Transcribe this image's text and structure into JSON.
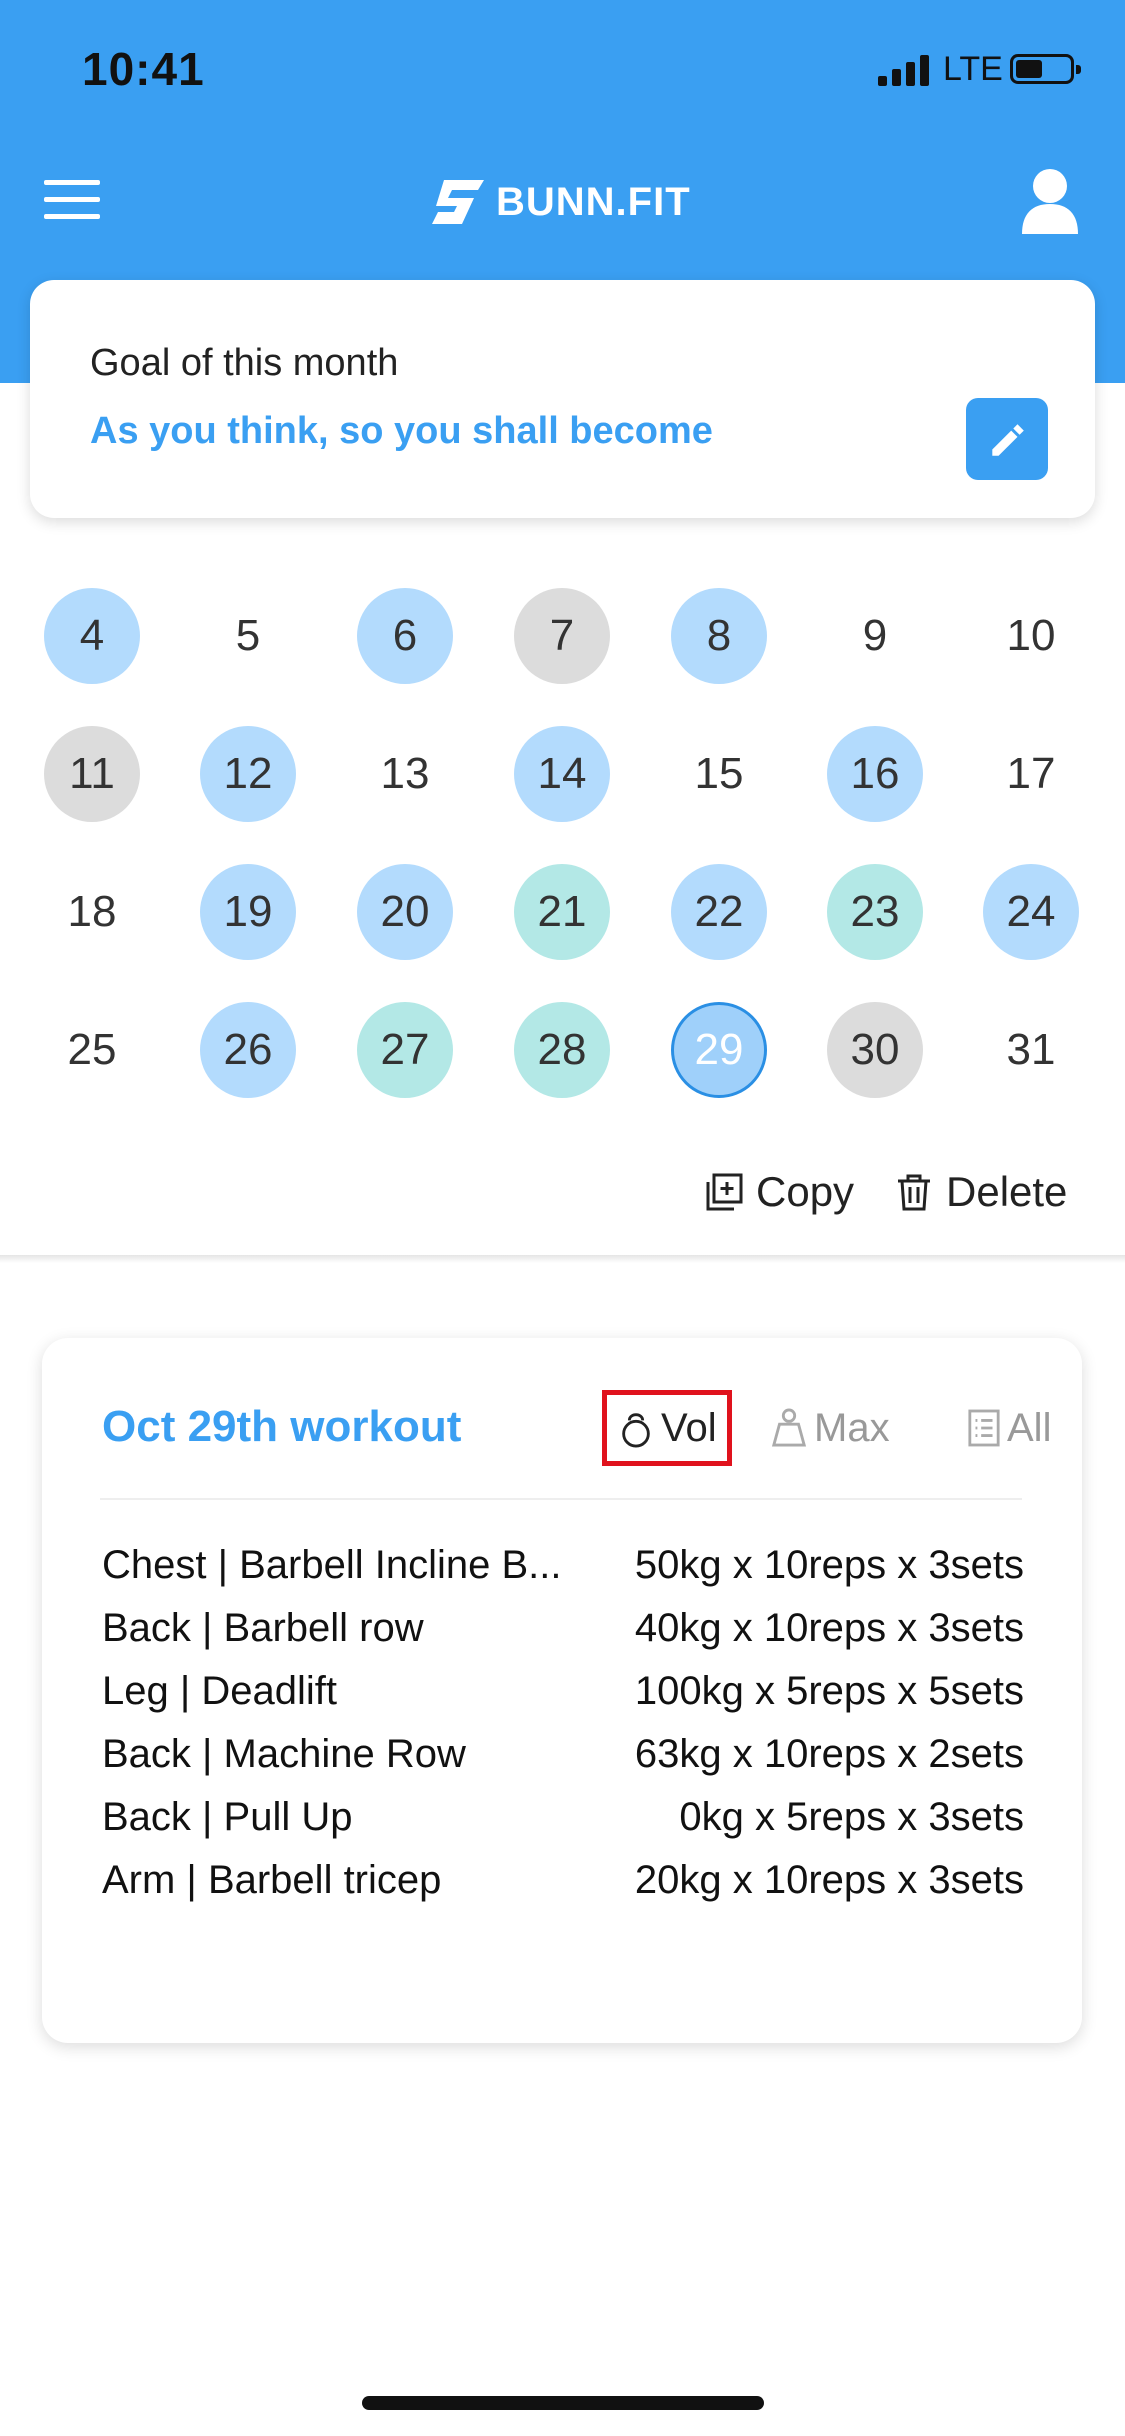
{
  "status_bar": {
    "time": "10:41",
    "network": "LTE"
  },
  "header": {
    "brand": "BUNN.FIT",
    "menu_icon": "hamburger-icon",
    "profile_icon": "user-icon"
  },
  "goal": {
    "label": "Goal of this month",
    "text": "As you think, so you shall become",
    "edit_icon": "pencil-icon"
  },
  "calendar": {
    "rows": [
      [
        {
          "day": "4",
          "state": "blue"
        },
        {
          "day": "5",
          "state": "none"
        },
        {
          "day": "6",
          "state": "blue"
        },
        {
          "day": "7",
          "state": "gray"
        },
        {
          "day": "8",
          "state": "blue"
        },
        {
          "day": "9",
          "state": "none"
        },
        {
          "day": "10",
          "state": "none"
        }
      ],
      [
        {
          "day": "11",
          "state": "gray"
        },
        {
          "day": "12",
          "state": "blue"
        },
        {
          "day": "13",
          "state": "none"
        },
        {
          "day": "14",
          "state": "blue"
        },
        {
          "day": "15",
          "state": "none"
        },
        {
          "day": "16",
          "state": "blue"
        },
        {
          "day": "17",
          "state": "none"
        }
      ],
      [
        {
          "day": "18",
          "state": "none"
        },
        {
          "day": "19",
          "state": "blue"
        },
        {
          "day": "20",
          "state": "blue"
        },
        {
          "day": "21",
          "state": "teal"
        },
        {
          "day": "22",
          "state": "blue"
        },
        {
          "day": "23",
          "state": "teal"
        },
        {
          "day": "24",
          "state": "blue"
        }
      ],
      [
        {
          "day": "25",
          "state": "none"
        },
        {
          "day": "26",
          "state": "blue"
        },
        {
          "day": "27",
          "state": "teal"
        },
        {
          "day": "28",
          "state": "teal"
        },
        {
          "day": "29",
          "state": "selected"
        },
        {
          "day": "30",
          "state": "gray"
        },
        {
          "day": "31",
          "state": "none"
        }
      ]
    ],
    "colors": {
      "blue": "#b3dbfd",
      "gray": "#dcdcdc",
      "teal": "#b3e8e6",
      "selected_border": "#2a8fe4"
    }
  },
  "actions": {
    "copy_label": "Copy",
    "delete_label": "Delete"
  },
  "workout": {
    "title": "Oct 29th workout",
    "tabs": {
      "vol": "Vol",
      "max": "Max",
      "all": "All"
    },
    "active_tab": "Vol",
    "exercises": [
      {
        "name": "Chest | Barbell Incline B...",
        "detail": "50kg x 10reps x 3sets"
      },
      {
        "name": "Back | Barbell row",
        "detail": "40kg x 10reps x 3sets"
      },
      {
        "name": "Leg | Deadlift",
        "detail": "100kg x 5reps x 5sets"
      },
      {
        "name": "Back | Machine Row",
        "detail": "63kg x 10reps x 2sets"
      },
      {
        "name": "Back | Pull Up",
        "detail": "0kg x 5reps x 3sets"
      },
      {
        "name": "Arm | Barbell tricep",
        "detail": "20kg x 10reps x 3sets"
      }
    ]
  },
  "theme": {
    "accent": "#3a9ff2",
    "highlight_border": "#e0121d"
  }
}
